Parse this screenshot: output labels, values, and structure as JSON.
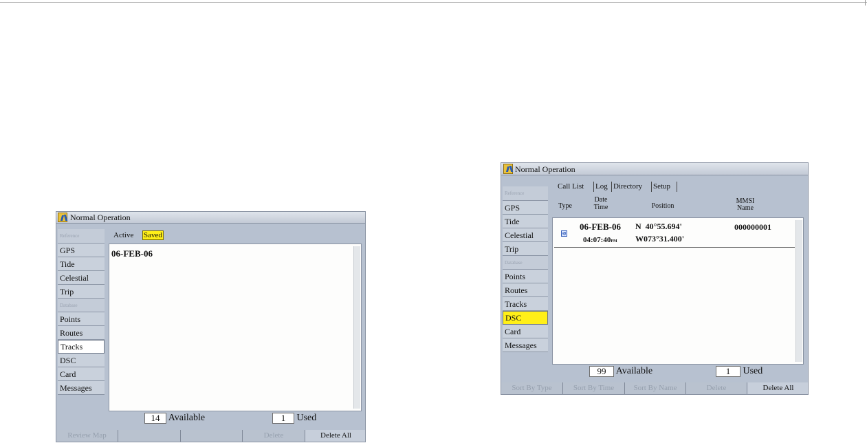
{
  "left_screen": {
    "title": "Normal Operation",
    "sidebar": [
      {
        "label": "Reference",
        "kind": "header"
      },
      {
        "label": "GPS"
      },
      {
        "label": "Tide"
      },
      {
        "label": "Celestial"
      },
      {
        "label": "Trip"
      },
      {
        "label": "Database",
        "kind": "header"
      },
      {
        "label": "Points"
      },
      {
        "label": "Routes"
      },
      {
        "label": "Tracks",
        "kind": "selected"
      },
      {
        "label": "DSC"
      },
      {
        "label": "Card"
      },
      {
        "label": "Messages"
      }
    ],
    "tabs": {
      "active": "Active",
      "saved": "Saved"
    },
    "list_items": [
      "06-FEB-06"
    ],
    "available_count": "14",
    "available_label": "Available",
    "used_count": "1",
    "used_label": "Used",
    "softkeys": [
      "Review Map",
      "",
      "",
      "Delete",
      "Delete All"
    ]
  },
  "right_screen": {
    "title": "Normal Operation",
    "sidebar": [
      {
        "label": "Reference",
        "kind": "header"
      },
      {
        "label": "GPS"
      },
      {
        "label": "Tide"
      },
      {
        "label": "Celestial"
      },
      {
        "label": "Trip"
      },
      {
        "label": "Database",
        "kind": "header"
      },
      {
        "label": "Points"
      },
      {
        "label": "Routes"
      },
      {
        "label": "Tracks"
      },
      {
        "label": "DSC",
        "kind": "highlight"
      },
      {
        "label": "Card"
      },
      {
        "label": "Messages"
      }
    ],
    "tabs": [
      "Call List",
      "Log",
      "Directory",
      "Setup"
    ],
    "columns": {
      "type": "Type",
      "date": "Date",
      "time": "Time",
      "position": "Position",
      "mmsi": "MMSI",
      "name": "Name"
    },
    "rows": [
      {
        "type_icon": "distress-call-icon",
        "date": "06-FEB-06",
        "time": "04:07:40",
        "ampm": "PM",
        "lat": "N  40°55.694'",
        "lon": "W073°31.400'",
        "mmsi": "000000001"
      }
    ],
    "available_count": "99",
    "available_label": "Available",
    "used_count": "1",
    "used_label": "Used",
    "softkeys": [
      "Sort By Type",
      "Sort By Time",
      "Sort By Name",
      "Delete",
      "Delete All"
    ]
  },
  "colors": {
    "screen_bg": "#b7c1d0",
    "highlight": "#ffef18",
    "panel": "#fdfdfc"
  }
}
